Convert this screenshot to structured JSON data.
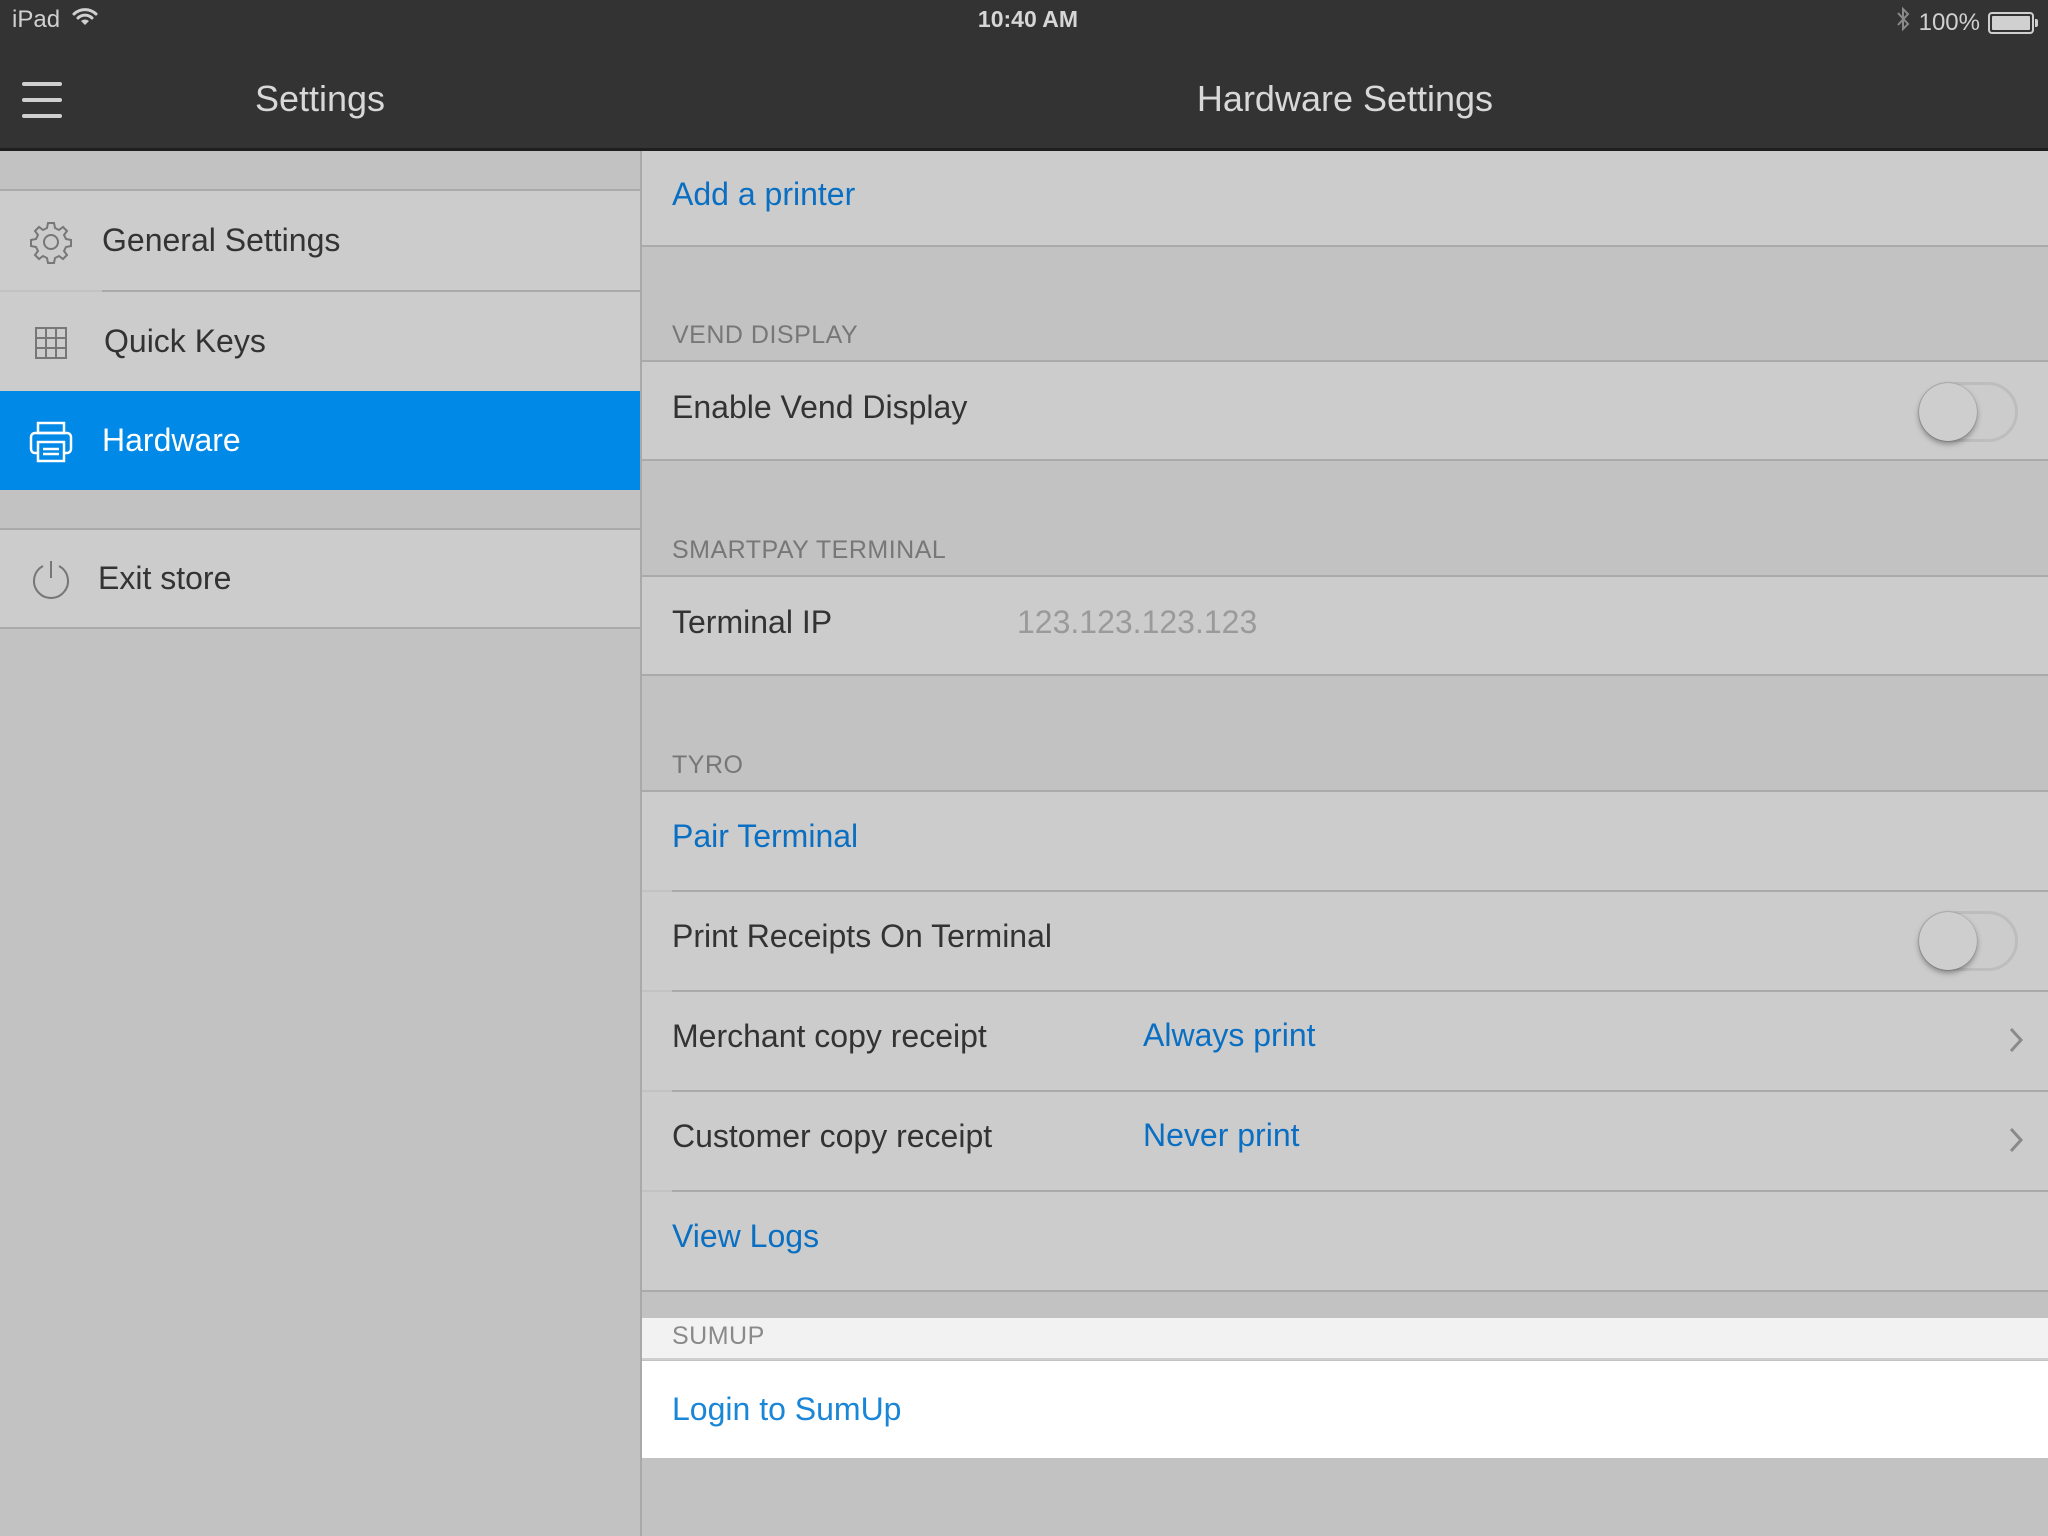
{
  "status_bar": {
    "device": "iPad",
    "time": "10:40 AM",
    "battery_percent_label": "100%",
    "battery_level": 1.0,
    "icons": [
      "wifi-icon",
      "bluetooth-icon",
      "battery-icon"
    ]
  },
  "sidebar": {
    "title": "Settings",
    "menu_icon": "hamburger-icon",
    "items": [
      {
        "label": "General Settings",
        "icon": "gear-icon",
        "selected": false
      },
      {
        "label": "Quick Keys",
        "icon": "grid-icon",
        "selected": false
      },
      {
        "label": "Hardware",
        "icon": "printer-icon",
        "selected": true
      }
    ],
    "footer_items": [
      {
        "label": "Exit store",
        "icon": "power-icon"
      }
    ]
  },
  "main": {
    "title": "Hardware Settings",
    "add_printer": "Add a printer",
    "sections": {
      "vend_display": {
        "header": "VEND DISPLAY",
        "enable_label": "Enable Vend Display",
        "enable_value": false
      },
      "smartpay": {
        "header": "SMARTPAY TERMINAL",
        "terminal_ip_label": "Terminal IP",
        "terminal_ip_placeholder": "123.123.123.123"
      },
      "tyro": {
        "header": "TYRO",
        "pair_terminal": "Pair Terminal",
        "print_receipts_label": "Print Receipts On Terminal",
        "print_receipts_value": false,
        "merchant_copy_label": "Merchant copy receipt",
        "merchant_copy_value": "Always print",
        "customer_copy_label": "Customer copy receipt",
        "customer_copy_value": "Never print",
        "view_logs": "View Logs"
      },
      "sumup": {
        "header": "SUMUP",
        "login": "Login to SumUp"
      }
    }
  },
  "colors": {
    "accent": "#0089e6",
    "link": "#0a6fc2",
    "navbar": "#333333",
    "row_bg": "#cccccc",
    "page_bg": "#c2c2c2"
  }
}
